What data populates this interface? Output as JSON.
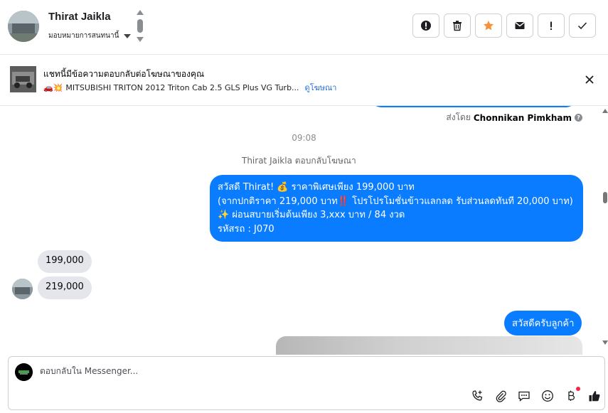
{
  "header": {
    "contact_name": "Thirat Jaikla",
    "assign_label": "มอบหมายการสนทนานี้",
    "actions": [
      {
        "name": "spam-button",
        "icon": "exclamation-circle-icon"
      },
      {
        "name": "delete-button",
        "icon": "trash-icon"
      },
      {
        "name": "star-button",
        "icon": "star-icon",
        "color": "#f7923b"
      },
      {
        "name": "mark-unread-button",
        "icon": "envelope-icon"
      },
      {
        "name": "follow-up-button",
        "icon": "exclamation-icon"
      },
      {
        "name": "mark-done-button",
        "icon": "check-icon"
      }
    ]
  },
  "ad": {
    "title": "แชทนี้มีข้อความตอบกลับต่อโฆษณาของคุณ",
    "emoji": "🚗💥",
    "subtitle": "MITSUBISHI TRITON 2012 Triton Cab 2.5 GLS Plus VG Turb...",
    "link": "ดูโฆษณา"
  },
  "chat": {
    "sent_by_prefix": "ส่งโดย",
    "sent_by_name": "Chonnikan Pimkham",
    "time": "09:08",
    "replied_note": "Thirat Jaikla ตอบกลับโฆษณา",
    "outgoing_1": [
      "สวัสดี Thirat! 💰 ราคาพิเศษเพียง 199,000 บาท",
      "(จากปกติราคา 219,000 บาท‼️ โปรโปรโมชั่นข้าวแลกลด รับส่วนลดทันที 20,000 บาท)",
      "✨ ผ่อนสบายเริ่มต้นเพียง 3,xxx บาท / 84 งวด",
      "รหัสรถ : J070"
    ],
    "incoming": [
      "199,000",
      "219,000"
    ],
    "outgoing_2": "สวัสดีครับลูกค้า"
  },
  "composer": {
    "placeholder": "ตอบกลับใน Messenger...",
    "tools": [
      "call-add-icon",
      "paperclip-icon",
      "chat-bubble-icon",
      "emoji-icon",
      "baht-icon",
      "thumbs-up-icon"
    ]
  },
  "colors": {
    "accent": "#0a7cff",
    "incoming_bg": "#e4e6eb",
    "star": "#f7923b",
    "notification_dot": "#f02849"
  }
}
